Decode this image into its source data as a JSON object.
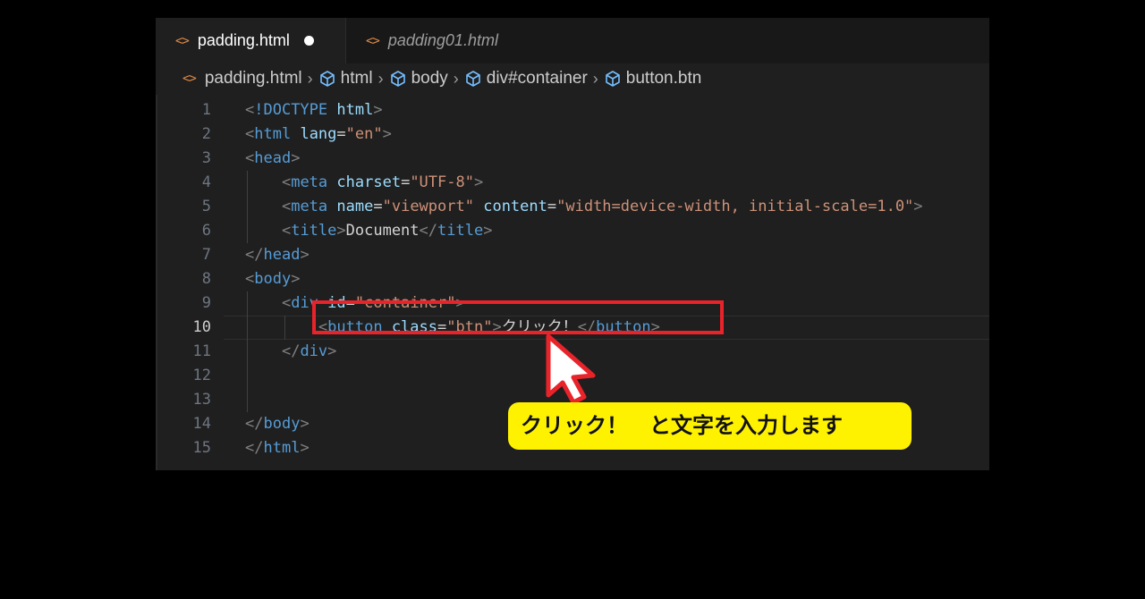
{
  "tabs": [
    {
      "icon": "code-icon",
      "label": "padding.html",
      "active": true,
      "modified": true
    },
    {
      "icon": "code-icon",
      "label": "padding01.html",
      "active": false,
      "modified": false
    }
  ],
  "breadcrumb": [
    {
      "icon": "code-icon",
      "label": "padding.html"
    },
    {
      "icon": "cube-icon",
      "label": "html"
    },
    {
      "icon": "cube-icon",
      "label": "body"
    },
    {
      "icon": "cube-icon",
      "label": "div#container"
    },
    {
      "icon": "cube-icon",
      "label": "button.btn"
    }
  ],
  "editor": {
    "current_line": 10,
    "lines": [
      {
        "n": "1",
        "tokens": [
          [
            "bracket",
            "<"
          ],
          [
            "tag",
            "!DOCTYPE"
          ],
          [
            "text",
            " "
          ],
          [
            "attr",
            "html"
          ],
          [
            "bracket",
            ">"
          ]
        ]
      },
      {
        "n": "2",
        "tokens": [
          [
            "bracket",
            "<"
          ],
          [
            "tag",
            "html"
          ],
          [
            "text",
            " "
          ],
          [
            "attr",
            "lang"
          ],
          [
            "text",
            "="
          ],
          [
            "str",
            "\"en\""
          ],
          [
            "bracket",
            ">"
          ]
        ]
      },
      {
        "n": "3",
        "tokens": [
          [
            "bracket",
            "<"
          ],
          [
            "tag",
            "head"
          ],
          [
            "bracket",
            ">"
          ]
        ]
      },
      {
        "n": "4",
        "tokens": [
          [
            "text",
            "    "
          ],
          [
            "bracket",
            "<"
          ],
          [
            "tag",
            "meta"
          ],
          [
            "text",
            " "
          ],
          [
            "attr",
            "charset"
          ],
          [
            "text",
            "="
          ],
          [
            "str",
            "\"UTF-8\""
          ],
          [
            "bracket",
            ">"
          ]
        ]
      },
      {
        "n": "5",
        "tokens": [
          [
            "text",
            "    "
          ],
          [
            "bracket",
            "<"
          ],
          [
            "tag",
            "meta"
          ],
          [
            "text",
            " "
          ],
          [
            "attr",
            "name"
          ],
          [
            "text",
            "="
          ],
          [
            "str",
            "\"viewport\""
          ],
          [
            "text",
            " "
          ],
          [
            "attr",
            "content"
          ],
          [
            "text",
            "="
          ],
          [
            "str",
            "\"width=device-width, initial-scale=1.0\""
          ],
          [
            "bracket",
            ">"
          ]
        ]
      },
      {
        "n": "6",
        "tokens": [
          [
            "text",
            "    "
          ],
          [
            "bracket",
            "<"
          ],
          [
            "tag",
            "title"
          ],
          [
            "bracket",
            ">"
          ],
          [
            "text",
            "Document"
          ],
          [
            "bracket",
            "</"
          ],
          [
            "tag",
            "title"
          ],
          [
            "bracket",
            ">"
          ]
        ]
      },
      {
        "n": "7",
        "tokens": [
          [
            "bracket",
            "</"
          ],
          [
            "tag",
            "head"
          ],
          [
            "bracket",
            ">"
          ]
        ]
      },
      {
        "n": "8",
        "tokens": [
          [
            "bracket",
            "<"
          ],
          [
            "tag",
            "body"
          ],
          [
            "bracket",
            ">"
          ]
        ]
      },
      {
        "n": "9",
        "tokens": [
          [
            "text",
            "    "
          ],
          [
            "bracket",
            "<"
          ],
          [
            "tag",
            "div"
          ],
          [
            "text",
            " "
          ],
          [
            "attr",
            "id"
          ],
          [
            "text",
            "="
          ],
          [
            "str",
            "\"container\""
          ],
          [
            "bracket",
            ">"
          ]
        ]
      },
      {
        "n": "10",
        "tokens": [
          [
            "text",
            "        "
          ],
          [
            "bracket",
            "<"
          ],
          [
            "tag",
            "button"
          ],
          [
            "text",
            " "
          ],
          [
            "attr",
            "class"
          ],
          [
            "text",
            "="
          ],
          [
            "str",
            "\"btn\""
          ],
          [
            "bracket",
            ">"
          ],
          [
            "text",
            "クリック！"
          ],
          [
            "bracket",
            "</"
          ],
          [
            "tag",
            "button"
          ],
          [
            "bracket",
            ">"
          ]
        ]
      },
      {
        "n": "11",
        "tokens": [
          [
            "text",
            "    "
          ],
          [
            "bracket",
            "</"
          ],
          [
            "tag",
            "div"
          ],
          [
            "bracket",
            ">"
          ]
        ]
      },
      {
        "n": "12",
        "tokens": []
      },
      {
        "n": "13",
        "tokens": []
      },
      {
        "n": "14",
        "tokens": [
          [
            "bracket",
            "</"
          ],
          [
            "tag",
            "body"
          ],
          [
            "bracket",
            ">"
          ]
        ]
      },
      {
        "n": "15",
        "tokens": [
          [
            "bracket",
            "</"
          ],
          [
            "tag",
            "html"
          ],
          [
            "bracket",
            ">"
          ]
        ]
      }
    ]
  },
  "annotation": {
    "callout_text": "クリック！　と文字を入力します",
    "box_color": "#e8232a",
    "callout_color": "#fff200"
  },
  "colors": {
    "editor_bg": "#1f1f1f",
    "tag": "#569cd6",
    "attr": "#9cdcfe",
    "string": "#ce9178",
    "bracket": "#808080",
    "file_icon": "#e38c47"
  }
}
